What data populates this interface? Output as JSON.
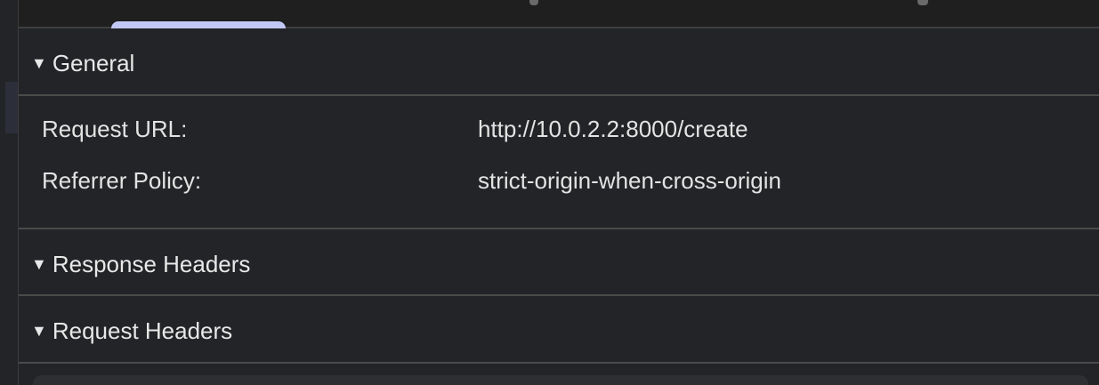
{
  "sections": {
    "general": {
      "toggle_icon": "▼",
      "title": "General",
      "rows": [
        {
          "key": "Request URL:",
          "value": "http://10.0.2.2:8000/create"
        },
        {
          "key": "Referrer Policy:",
          "value": "strict-origin-when-cross-origin"
        }
      ]
    },
    "response_headers": {
      "toggle_icon": "▼",
      "title": "Response Headers"
    },
    "request_headers": {
      "toggle_icon": "▼",
      "title": "Request Headers"
    }
  },
  "colors": {
    "background": "#202124",
    "text": "#e3e3e3",
    "divider": "#4a4a4a",
    "selected_tab_indicator": "#c2c8f5"
  }
}
